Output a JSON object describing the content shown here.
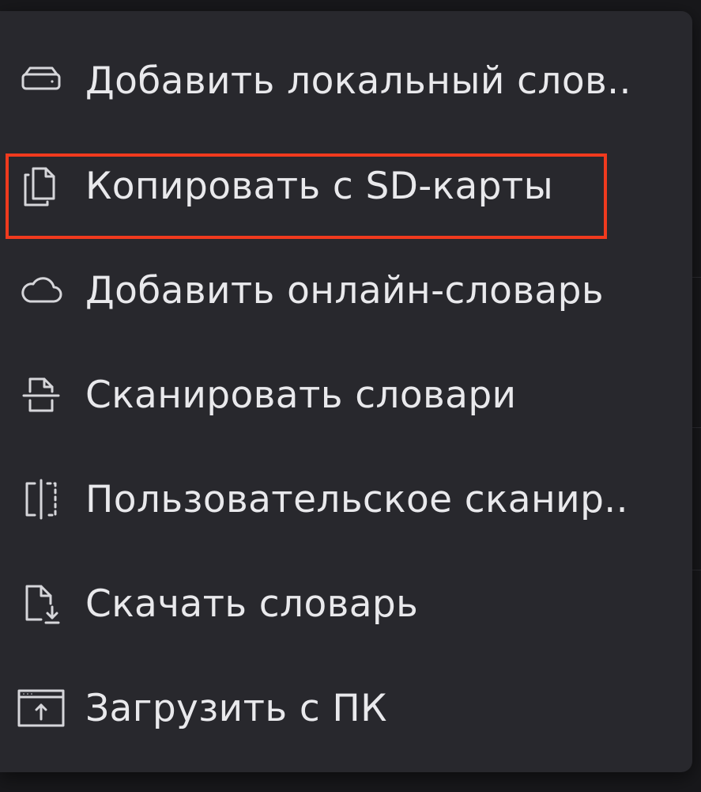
{
  "menu": {
    "items": [
      {
        "label": "Добавить локальный слов..",
        "icon": "local-drive-icon"
      },
      {
        "label": "Копировать с SD-карты",
        "icon": "copy-files-icon"
      },
      {
        "label": "Добавить онлайн-словарь",
        "icon": "cloud-icon"
      },
      {
        "label": "Сканировать словари",
        "icon": "scan-document-icon"
      },
      {
        "label": "Пользовательское сканир..",
        "icon": "custom-scan-icon"
      },
      {
        "label": "Скачать словарь",
        "icon": "download-file-icon"
      },
      {
        "label": "Загрузить с ПК",
        "icon": "upload-window-icon"
      }
    ],
    "highlighted_item": "Копировать с SD-карты"
  },
  "colors": {
    "menu_background": "#28282d",
    "text": "#e9e9ec",
    "icon_stroke": "#d6d6da",
    "highlight_border": "#f03a1e"
  }
}
